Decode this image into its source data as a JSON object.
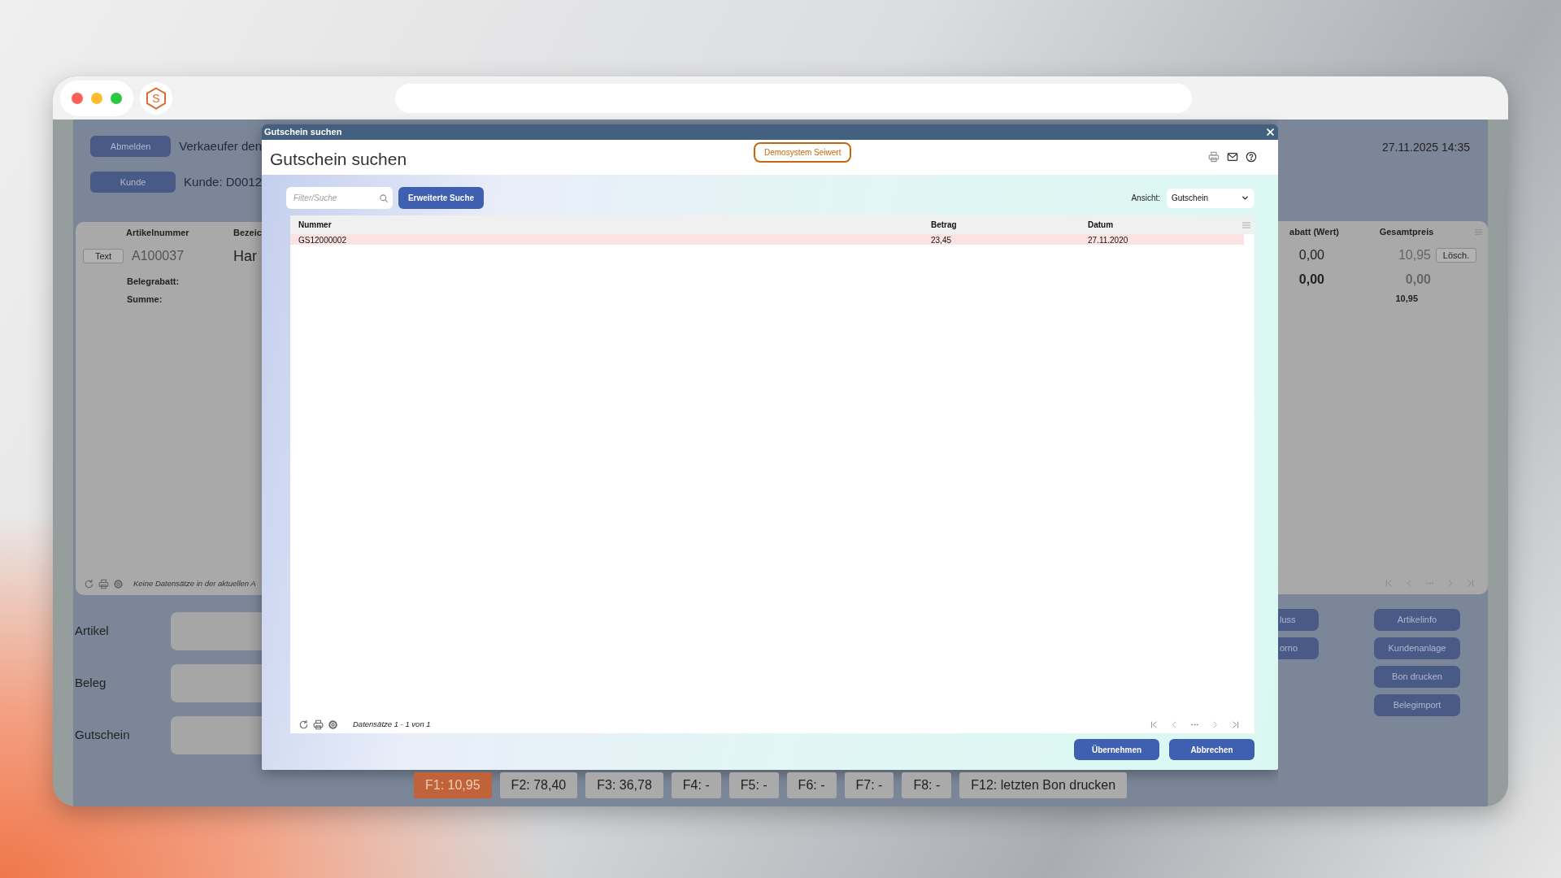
{
  "browser": {
    "logo_text": "S"
  },
  "header": {
    "logout_button": "Abmelden",
    "seller": "Verkaeufer den",
    "customer_button": "Kunde",
    "customer": "Kunde: D0012",
    "datetime": "27.11.2025 14:35"
  },
  "cart": {
    "columns_left": [
      "Artikelnummer",
      "Bezeic"
    ],
    "columns_right": [
      "abatt (Wert)",
      "Gesamtpreis"
    ],
    "item": {
      "type_button": "Text",
      "article": "A100037",
      "name": "Har",
      "discount": "0,00",
      "total": "10,95",
      "delete_button": "Lösch."
    },
    "receipt_discount": {
      "label": "Belegrabatt:",
      "discount": "0,00",
      "total": "0,00"
    },
    "sum": {
      "label": "Summe:",
      "total": "10,95"
    },
    "footer_text": "Keine Datensätze in der aktuellen A"
  },
  "inputs": [
    {
      "label": "Artikel"
    },
    {
      "label": "Beleg"
    },
    {
      "label": "Gutschein"
    }
  ],
  "side_buttons_partial": [
    "luss",
    "orno"
  ],
  "side_buttons": [
    "Artikelinfo",
    "Kundenanlage",
    "Bon drucken",
    "Belegimport"
  ],
  "function_keys": [
    {
      "label": "F1: 10,95",
      "selected": true
    },
    {
      "label": "F2: 78,40",
      "selected": false
    },
    {
      "label": "F3: 36,78",
      "selected": false
    },
    {
      "label": "F4: -",
      "selected": false
    },
    {
      "label": "F5: -",
      "selected": false
    },
    {
      "label": "F6: -",
      "selected": false
    },
    {
      "label": "F7: -",
      "selected": false
    },
    {
      "label": "F8: -",
      "selected": false
    },
    {
      "label": "F12: letzten Bon drucken",
      "selected": false
    }
  ],
  "dialog": {
    "window_title": "Gutschein suchen",
    "title": "Gutschein suchen",
    "badge": "Demosystem Seiwert",
    "search": {
      "placeholder": "Filter/Suche"
    },
    "advanced_button": "Erweiterte Suche",
    "view_label": "Ansicht:",
    "view_value": "Gutschein",
    "table": {
      "columns": [
        "Nummer",
        "Betrag",
        "Datum"
      ],
      "rows": [
        {
          "cells": [
            "GS12000002",
            "23,45",
            "27.11.2020"
          ],
          "selected": true
        }
      ]
    },
    "footer_text": "Datensätze 1 - 1 von 1",
    "buttons": [
      "Übernehmen",
      "Abbrechen"
    ]
  }
}
